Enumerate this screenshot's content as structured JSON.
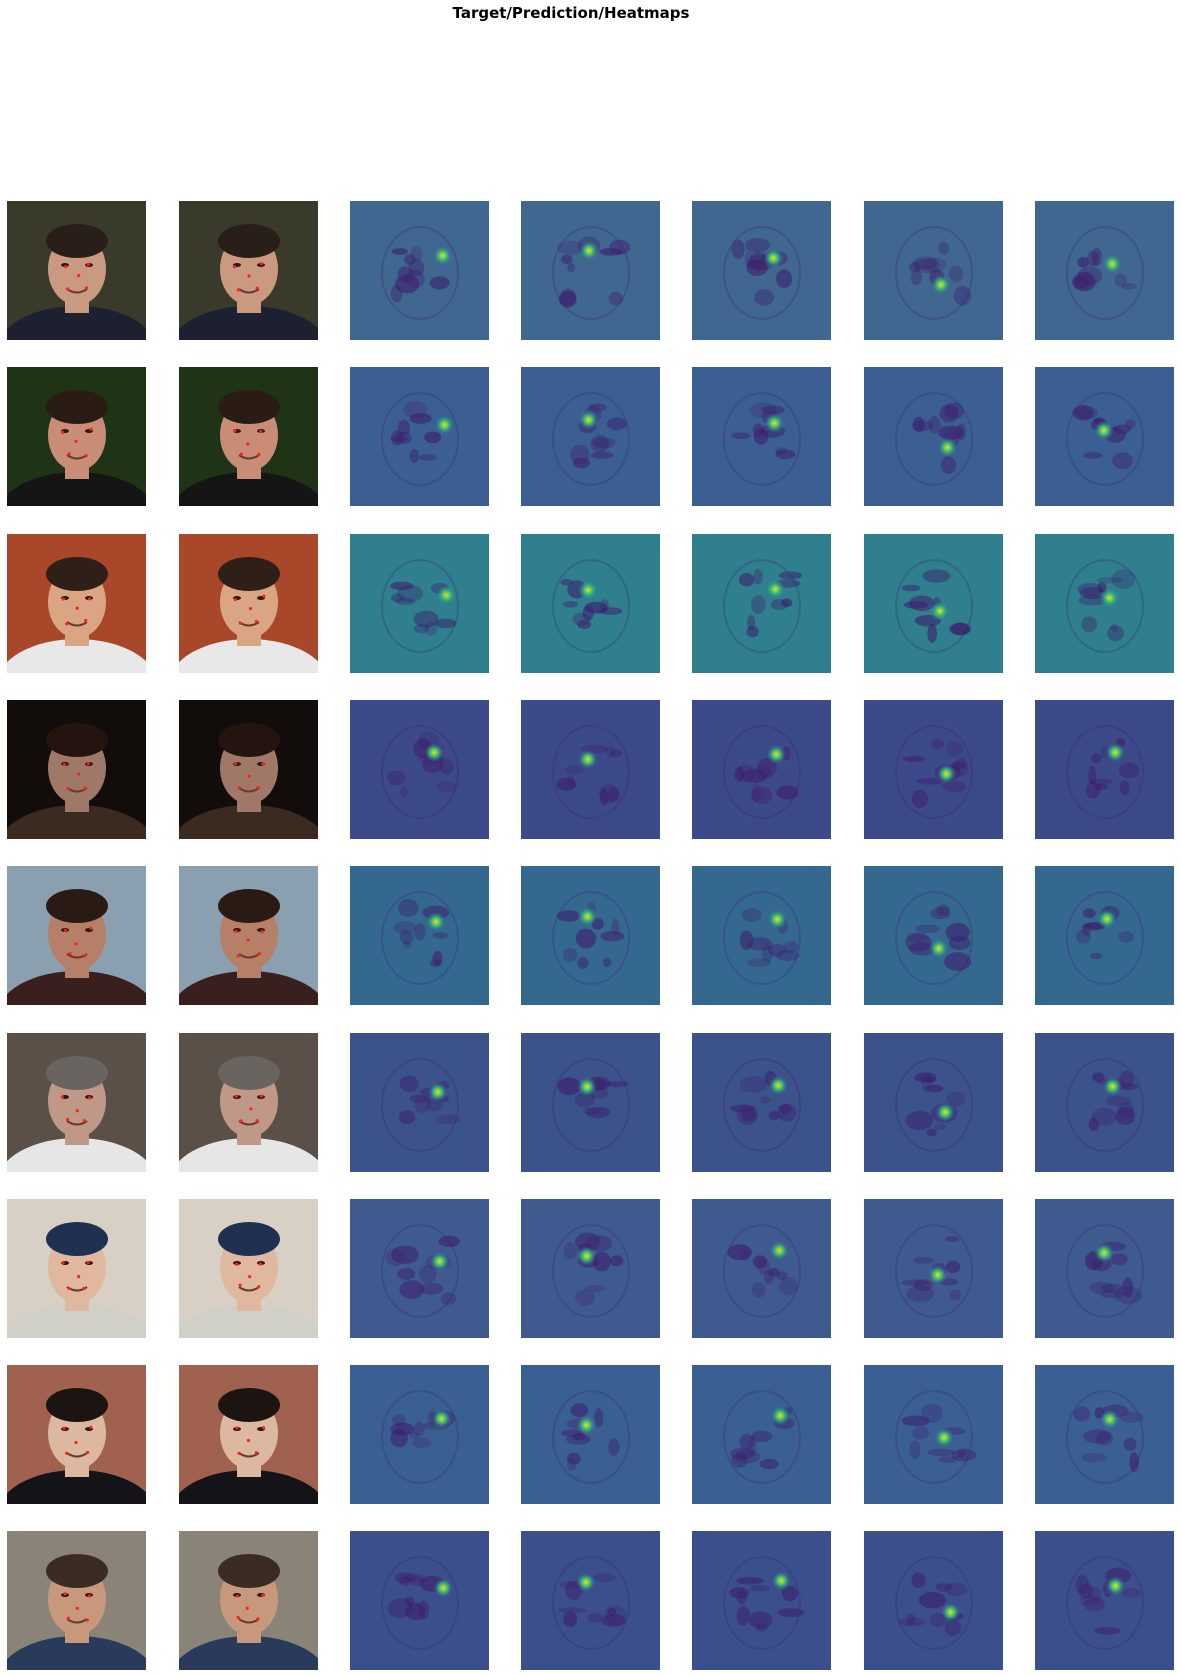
{
  "figure": {
    "title": "Target/Prediction/Heatmaps"
  },
  "palette": {
    "heatmap_background": "#3b5f92",
    "heatmap_dark": "#3d1c6b",
    "heatmap_peak": "#e5e419",
    "heatmap_mid": "#35b779",
    "keypoint": "#ff2020"
  },
  "rows": [
    {
      "photo": {
        "bg": "#3a3a2a",
        "skin": "#c99a80",
        "hair": "#2a1e18",
        "shirt": "#1c2030"
      },
      "heatmap_tone": "#3f6790"
    },
    {
      "photo": {
        "bg": "#1f3316",
        "skin": "#c98c76",
        "hair": "#2a1c14",
        "shirt": "#151515"
      },
      "heatmap_tone": "#3b5f92"
    },
    {
      "photo": {
        "bg": "#a9472a",
        "skin": "#d9a583",
        "hair": "#2e2018",
        "shirt": "#e8e8e8"
      },
      "heatmap_tone": "#2f7f8e"
    },
    {
      "photo": {
        "bg": "#120c0a",
        "skin": "#a07868",
        "hair": "#241410",
        "shirt": "#3a2a20"
      },
      "heatmap_tone": "#3d4a8a"
    },
    {
      "photo": {
        "bg": "#8aa0b0",
        "skin": "#b57f68",
        "hair": "#2a1a14",
        "shirt": "#3a1f1f"
      },
      "heatmap_tone": "#35688f"
    },
    {
      "photo": {
        "bg": "#5a5048",
        "skin": "#c09888",
        "hair": "#6a6460",
        "shirt": "#e6e6e6"
      },
      "heatmap_tone": "#3b528b"
    },
    {
      "photo": {
        "bg": "#d8d0c4",
        "skin": "#e0b8a0",
        "hair": "#203050",
        "shirt": "#d0d0c8"
      },
      "heatmap_tone": "#3e5a8f"
    },
    {
      "photo": {
        "bg": "#a0624e",
        "skin": "#ddb8a0",
        "hair": "#1c1410",
        "shirt": "#141418"
      },
      "heatmap_tone": "#3a5f92"
    },
    {
      "photo": {
        "bg": "#8a8478",
        "skin": "#c8987c",
        "hair": "#3a2c24",
        "shirt": "#2a3a5a"
      },
      "heatmap_tone": "#3b4f8c"
    }
  ]
}
